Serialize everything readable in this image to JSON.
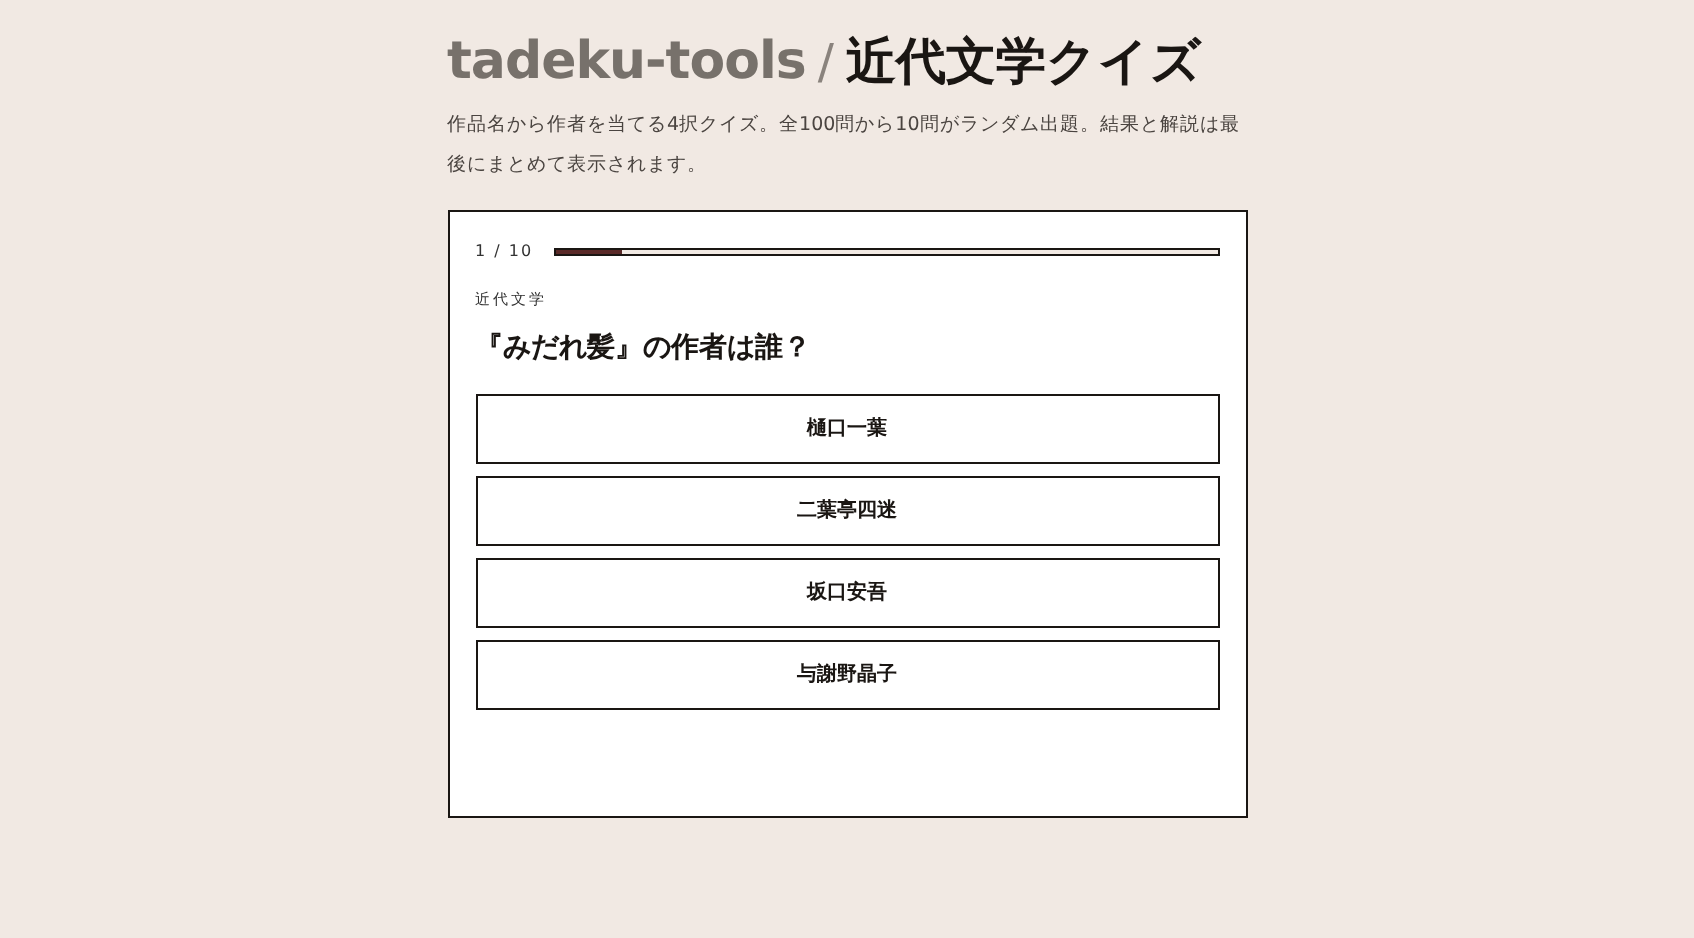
{
  "header": {
    "brand": "tadeku-tools",
    "separator": "/",
    "title": "近代文学クイズ",
    "description": "作品名から作者を当てる4択クイズ。全100問から10問がランダム出題。結果と解説は最後にまとめて表示されます。"
  },
  "quiz": {
    "counter": "1 / 10",
    "progress": {
      "level": 0.1
    },
    "category": "近代文学",
    "question": "『みだれ髪』の作者は誰？",
    "options": [
      {
        "label": "樋口一葉",
        "selected": false
      },
      {
        "label": "二葉亭四迷",
        "selected": false
      },
      {
        "label": "坂口安吾",
        "selected": false
      },
      {
        "label": "与謝野晶子",
        "selected": false
      }
    ]
  }
}
